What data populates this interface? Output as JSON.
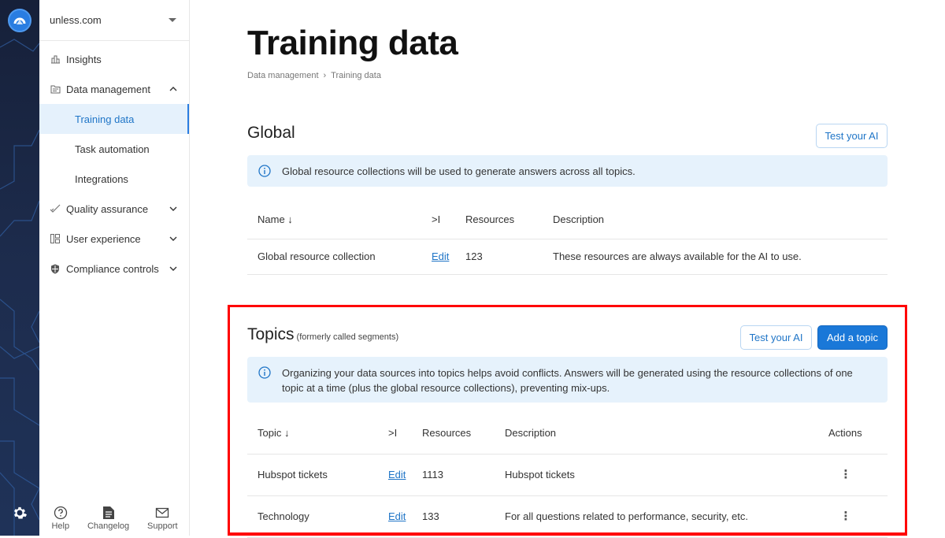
{
  "app": {
    "org_name": "unless.com",
    "logo_icon": "unless-logo-icon",
    "settings_icon": "gear-icon"
  },
  "sidebar": {
    "items": [
      {
        "label": "Insights",
        "icon": "bar-chart-icon",
        "expandable": false
      },
      {
        "label": "Data management",
        "icon": "folder-icon",
        "expandable": true,
        "expanded": true,
        "children": [
          {
            "label": "Training data",
            "active": true
          },
          {
            "label": "Task automation",
            "active": false
          },
          {
            "label": "Integrations",
            "active": false
          }
        ]
      },
      {
        "label": "Quality assurance",
        "icon": "check-icon",
        "expandable": true,
        "expanded": false
      },
      {
        "label": "User experience",
        "icon": "layout-icon",
        "expandable": true,
        "expanded": false
      },
      {
        "label": "Compliance controls",
        "icon": "shield-icon",
        "expandable": true,
        "expanded": false
      }
    ],
    "footer": [
      {
        "label": "Help",
        "icon": "help-circle-icon"
      },
      {
        "label": "Changelog",
        "icon": "document-icon"
      },
      {
        "label": "Support",
        "icon": "mail-icon"
      }
    ]
  },
  "page": {
    "title": "Training data",
    "breadcrumb": [
      "Data management",
      "Training data"
    ],
    "breadcrumb_separator": "›"
  },
  "global": {
    "heading": "Global",
    "test_button": "Test your AI",
    "info": "Global resource collections will be used to generate answers across all topics.",
    "columns": [
      "Name ↓",
      ">I",
      "Resources",
      "Description"
    ],
    "rows": [
      {
        "name": "Global resource collection",
        "edit": "Edit",
        "resources": "123",
        "description": "These resources are always available for the AI to use."
      }
    ]
  },
  "topics": {
    "heading": "Topics",
    "subheading": "(formerly called segments)",
    "test_button": "Test your AI",
    "add_button": "Add a topic",
    "info": "Organizing your data sources into topics helps avoid conflicts. Answers will be generated using the resource collections of one topic at a time (plus the global resource collections), preventing mix-ups.",
    "columns": [
      "Topic ↓",
      ">I",
      "Resources",
      "Description",
      "Actions"
    ],
    "rows": [
      {
        "name": "Hubspot tickets",
        "edit": "Edit",
        "resources": "1113",
        "description": "Hubspot tickets",
        "actions_icon": "more-vertical-icon"
      },
      {
        "name": "Technology",
        "edit": "Edit",
        "resources": "133",
        "description": "For all questions related to performance, security, etc.",
        "actions_icon": "more-vertical-icon"
      }
    ]
  },
  "colors": {
    "accent": "#1a78d8",
    "rail_bg": "#1d2c4d",
    "info_bg": "#e6f2fc",
    "active_nav_bg": "#e5f1fc",
    "highlight_border": "#ff0000"
  }
}
